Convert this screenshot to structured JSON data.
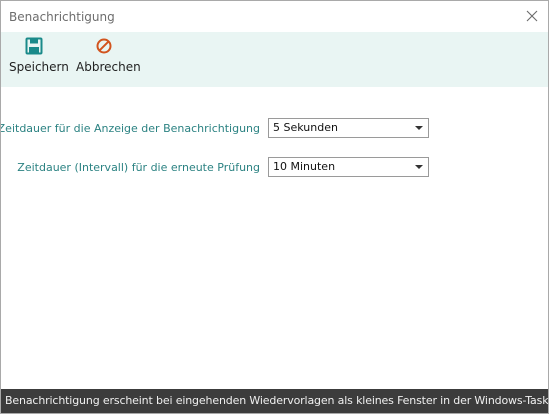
{
  "window": {
    "title": "Benachrichtigung"
  },
  "toolbar": {
    "save": {
      "label": "Speichern",
      "icon": "save-icon",
      "color": "#1a8a8a"
    },
    "cancel": {
      "label": "Abbrechen",
      "icon": "cancel-icon",
      "color": "#d2541e"
    }
  },
  "form": {
    "duration": {
      "label": "Zeitdauer für die Anzeige der Benachrichtigung",
      "value": "5 Sekunden"
    },
    "interval": {
      "label": "Zeitdauer (Intervall) für die erneute Prüfung",
      "value": "10 Minuten"
    }
  },
  "status": {
    "text": "Benachrichtigung erscheint bei eingehenden Wiedervorlagen als kleines Fenster in der Windows-Taskleiste."
  },
  "colors": {
    "toolbar_bg": "#e9f5f3",
    "label_text": "#2b8282",
    "statusbar_bg": "#3c3c3c"
  }
}
